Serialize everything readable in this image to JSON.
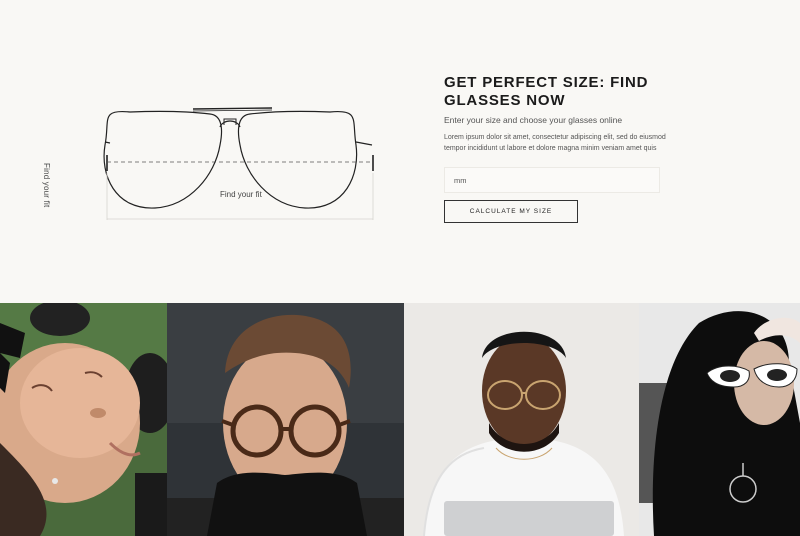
{
  "fit_section": {
    "vertical_label": "Find your fit",
    "horizontal_label": "Find your fit",
    "title": "GET PERFECT SIZE: FIND GLASSES NOW",
    "subtitle": "Enter your size and choose your glasses online",
    "body": "Lorem ipsum dolor sit amet, consectetur adipiscing elit, sed do eiusmod tempor incididunt ut labore et dolore magna minim veniam amet quis",
    "input_placeholder": "mm",
    "button_label": "CALCULATE MY SIZE"
  },
  "gallery": {
    "items": [
      {
        "name": "woman-sunglasses-on-grass"
      },
      {
        "name": "man-round-tortoise-glasses"
      },
      {
        "name": "man-wire-round-glasses"
      },
      {
        "name": "woman-white-cat-eye-sunglasses"
      }
    ]
  }
}
